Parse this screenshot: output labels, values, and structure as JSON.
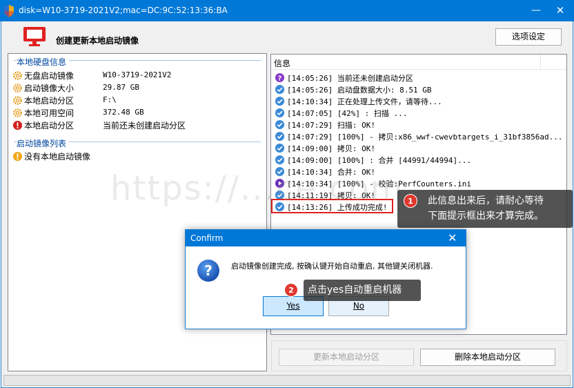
{
  "window": {
    "title": "disk=W10-3719-2021V2;mac=DC:9C:52:13:36:BA",
    "minimize": "—",
    "close": "✕"
  },
  "header": {
    "title": "创建更新本地启动镜像",
    "options_button": "选项设定"
  },
  "left_panel": {
    "local_disk_group": "本地硬盘信息",
    "rows": [
      {
        "icon": "gear-icon",
        "label": "无盘启动镜像",
        "value": "W10-3719-2021V2"
      },
      {
        "icon": "gear-icon",
        "label": "启动镜像大小",
        "value": "29.87 GB"
      },
      {
        "icon": "gear-icon",
        "label": "本地启动分区",
        "value": "F:\\"
      },
      {
        "icon": "gear-icon",
        "label": "本地可用空间",
        "value": "372.48 GB"
      },
      {
        "icon": "error-icon",
        "label": "本地启动分区",
        "value": "当前还未创建启动分区"
      }
    ],
    "image_list_group": "启动镜像列表",
    "image_list_rows": [
      {
        "icon": "warning-icon",
        "label": "没有本地启动镜像"
      }
    ]
  },
  "log_panel": {
    "column_header": "信息",
    "rows": [
      {
        "icon": "question-icon",
        "text": "[14:05:26] 当前还未创建启动分区"
      },
      {
        "icon": "check-icon",
        "text": "[14:05:26] 启动盘数据大小: 8.51 GB"
      },
      {
        "icon": "check-icon",
        "text": "[14:10:34] 正在处理上传文件，请等待..."
      },
      {
        "icon": "check-icon",
        "text": "[14:07:05] [42%] : 扫描 ..."
      },
      {
        "icon": "check-icon",
        "text": "[14:07:29] 扫描: OK!"
      },
      {
        "icon": "check-icon",
        "text": "[14:07:29] [100%] - 拷贝:x86_wwf-cwevbtargets_i_31bf3856ad..."
      },
      {
        "icon": "check-icon",
        "text": "[14:09:00] 拷贝: OK!"
      },
      {
        "icon": "check-icon",
        "text": "[14:09:00] [100%] : 合并 [44991/44994]..."
      },
      {
        "icon": "check-icon",
        "text": "[14:10:34] 合并: OK!"
      },
      {
        "icon": "play-icon",
        "text": "[14:10:34] [100%] - 校验:PerfCounters.ini"
      },
      {
        "icon": "check-icon",
        "text": "[14:11:19] 拷贝: OK!"
      },
      {
        "icon": "check-icon",
        "text": "[14:13:26] 上传成功完成!"
      }
    ]
  },
  "bottom_buttons": {
    "update_label": "更新本地启动分区",
    "delete_label": "删除本地启动分区"
  },
  "watermark": "https://...ce.com",
  "dialog": {
    "title": "Confirm",
    "close": "✕",
    "message": "启动镜像创建完成, 按确认键开始自动重启, 其他键关闭机器.",
    "yes_label": "Yes",
    "no_label": "No"
  },
  "callouts": [
    {
      "number": "1",
      "text_line1": "此信息出来后，请耐心等待",
      "text_line2": "下面提示框出来才算完成。"
    },
    {
      "number": "2",
      "text": "点击yes自动重启机器"
    }
  ],
  "colors": {
    "titlebar": "#0078d7",
    "accent_blue_label": "#0046a0",
    "highlight_red": "#e02020",
    "callout_badge": "#e0392e"
  }
}
